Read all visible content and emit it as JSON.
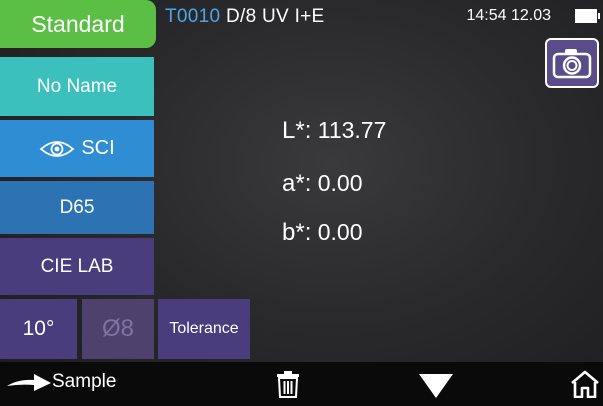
{
  "top": {
    "standard_tab": "Standard",
    "code": "T0010",
    "geometry_mode": "D/8 UV  I+E",
    "time_voltage": "14:54  12.03"
  },
  "menu": {
    "name": "No Name",
    "mode": "SCI",
    "illuminant": "D65",
    "color_space": "CIE LAB",
    "observer": "10°",
    "aperture": "Ø8",
    "tolerance": "Tolerance"
  },
  "values": {
    "L": {
      "label": "L*:",
      "value": "113.77"
    },
    "a": {
      "label": "a*:",
      "value": "0.00"
    },
    "b": {
      "label": "b*:",
      "value": "0.00"
    }
  },
  "bottom": {
    "sample_label": "Sample"
  },
  "icons": [
    "camera-icon",
    "eye-icon",
    "arrow-right-icon",
    "trash-icon",
    "triangle-down-icon",
    "home-icon",
    "battery-icon"
  ],
  "colors": {
    "standard_green": "#5cbf45",
    "code_blue": "#4aa6e8",
    "teal": "#3cc0be",
    "blue": "#2f8ed3",
    "dark_blue": "#2d73b4",
    "purple": "#4a3d7d"
  }
}
